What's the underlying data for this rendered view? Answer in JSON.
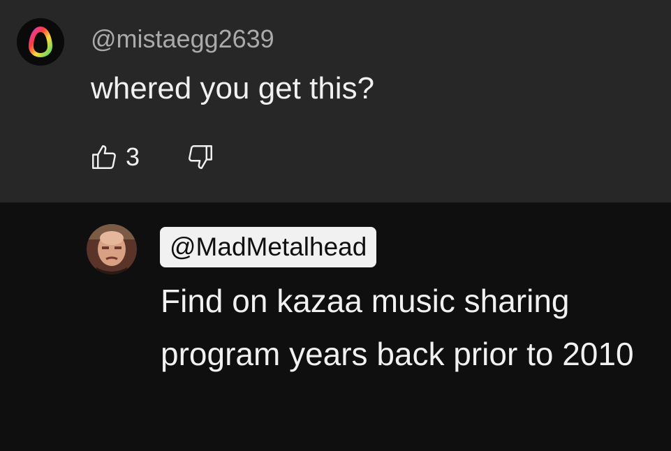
{
  "comment": {
    "username": "@mistaegg2639",
    "text": "whered you get this?",
    "like_count": "3"
  },
  "reply": {
    "username": "@MadMetalhead",
    "text": "Find on kazaa music sharing program years back prior to 2010"
  },
  "icons": {
    "like": "thumbs-up-icon",
    "dislike": "thumbs-down-icon"
  },
  "colors": {
    "top_background": "#272727",
    "reply_background": "#0f0f0f",
    "username_gray": "#aaaaaa",
    "chip_background": "#f1f1f1"
  }
}
